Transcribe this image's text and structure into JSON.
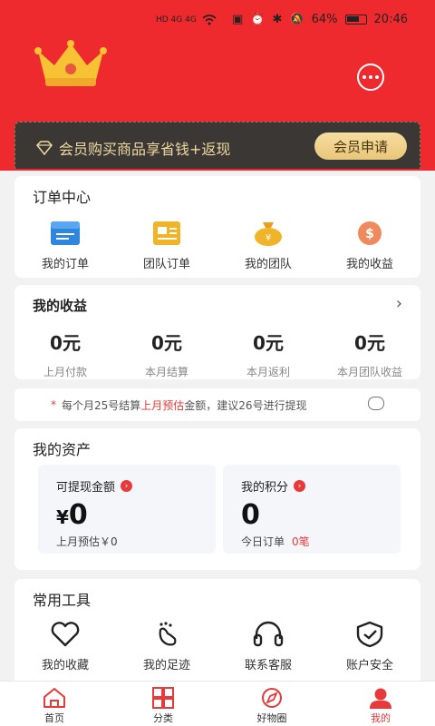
{
  "status_bar": {
    "left_indicators": "HD 4G 4G",
    "battery": "64%",
    "time": "20:46"
  },
  "header": {
    "crown_icon": "crown-icon",
    "message_icon": "chat-bubble-icon"
  },
  "vip": {
    "text": "会员购买商品享省钱+返现",
    "button": "会员申请"
  },
  "orders": {
    "title": "订单中心",
    "items": [
      {
        "label": "我的订单",
        "icon": "my-orders-icon",
        "color": "#2e86de"
      },
      {
        "label": "团队订单",
        "icon": "team-orders-icon",
        "color": "#f0b429"
      },
      {
        "label": "我的团队",
        "icon": "money-bag-icon",
        "color": "#f0b429"
      },
      {
        "label": "我的收益",
        "icon": "earnings-dollar-icon",
        "color": "#f08a5d"
      }
    ]
  },
  "earnings": {
    "title": "我的收益",
    "items": [
      {
        "value": "0元",
        "label": "上月付款"
      },
      {
        "value": "0元",
        "label": "本月结算"
      },
      {
        "value": "0元",
        "label": "本月返利"
      },
      {
        "value": "0元",
        "label": "本月团队收益"
      }
    ]
  },
  "notice": {
    "star": "*",
    "prefix": "每个月25号结算",
    "highlight": "上月预估",
    "suffix": "金额，建议26号进行提现"
  },
  "assets": {
    "title": "我的资产",
    "withdraw": {
      "title": "可提现金额",
      "currency": "¥",
      "value": "0",
      "footer": "上月预估￥0"
    },
    "points": {
      "title": "我的积分",
      "value": "0",
      "footer_label": "今日订单",
      "footer_value": "0笔"
    }
  },
  "tools": {
    "title": "常用工具",
    "items": [
      {
        "label": "我的收藏",
        "icon": "heart-icon"
      },
      {
        "label": "我的足迹",
        "icon": "footprint-icon"
      },
      {
        "label": "联系客服",
        "icon": "headset-icon"
      },
      {
        "label": "账户安全",
        "icon": "shield-check-icon"
      }
    ]
  },
  "tabbar": {
    "items": [
      {
        "label": "首页",
        "icon": "home-icon",
        "active": false
      },
      {
        "label": "分类",
        "icon": "category-grid-icon",
        "active": false
      },
      {
        "label": "好物圈",
        "icon": "compass-icon",
        "active": false
      },
      {
        "label": "我的",
        "icon": "user-icon",
        "active": true
      }
    ]
  },
  "colors": {
    "brand_red": "#ee2a2e",
    "vip_bg": "#3a3735",
    "vip_gold": "#f0d9a0"
  }
}
